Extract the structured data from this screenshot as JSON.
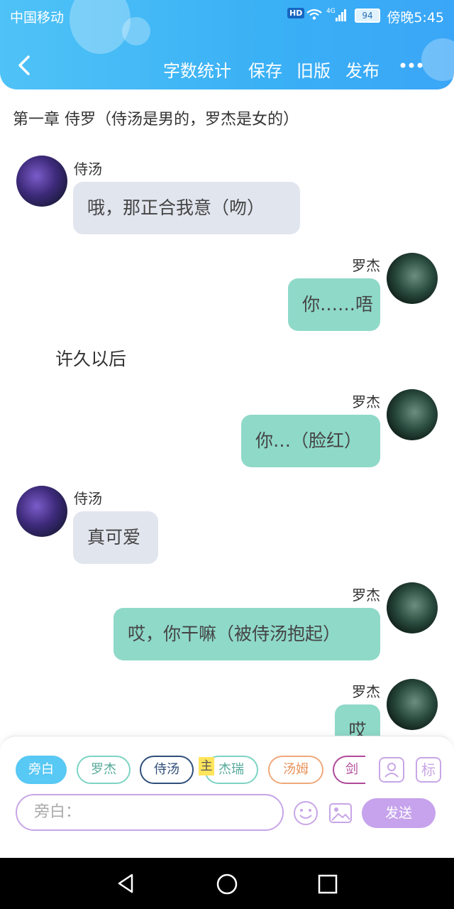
{
  "status_bar": {
    "carrier": "中国移动",
    "hd_badge": "HD",
    "network": "4G",
    "battery": "94",
    "clock": "傍晚5:45"
  },
  "toolbar": {
    "back_icon": "chevron-left-icon",
    "word_count": "字数统计",
    "save": "保存",
    "old_version": "旧版",
    "publish": "发布",
    "more_icon": "more-dots-icon"
  },
  "chapter_title": "第一章  侍罗（侍汤是男的，罗杰是女的）",
  "messages": [
    {
      "speaker": "侍汤",
      "text": "哦，那正合我意（吻）"
    },
    {
      "speaker": "罗杰",
      "text": "你……唔"
    },
    {
      "speaker": "narration",
      "text": "许久以后"
    },
    {
      "speaker": "罗杰",
      "text": "你…（脸红）"
    },
    {
      "speaker": "侍汤",
      "text": "真可爱"
    },
    {
      "speaker": "罗杰",
      "text": "哎，你干嘛（被侍汤抱起）"
    },
    {
      "speaker": "罗杰",
      "text": "哎"
    }
  ],
  "characters": {
    "narrator": "旁白",
    "c1": "罗杰",
    "c2": "侍汤",
    "c3": "杰瑞",
    "c4": "汤姆",
    "c5": "剑",
    "main_badge": "主"
  },
  "input": {
    "placeholder": "旁白：",
    "send": "发送",
    "tag_icon_label": "标"
  },
  "colors": {
    "header": "#3aaef5",
    "left_bubble": "#e1e5ee",
    "right_bubble": "#8fd9c9",
    "accent_purple": "#c6a3ec",
    "narrator_chip": "#58c8f5"
  }
}
